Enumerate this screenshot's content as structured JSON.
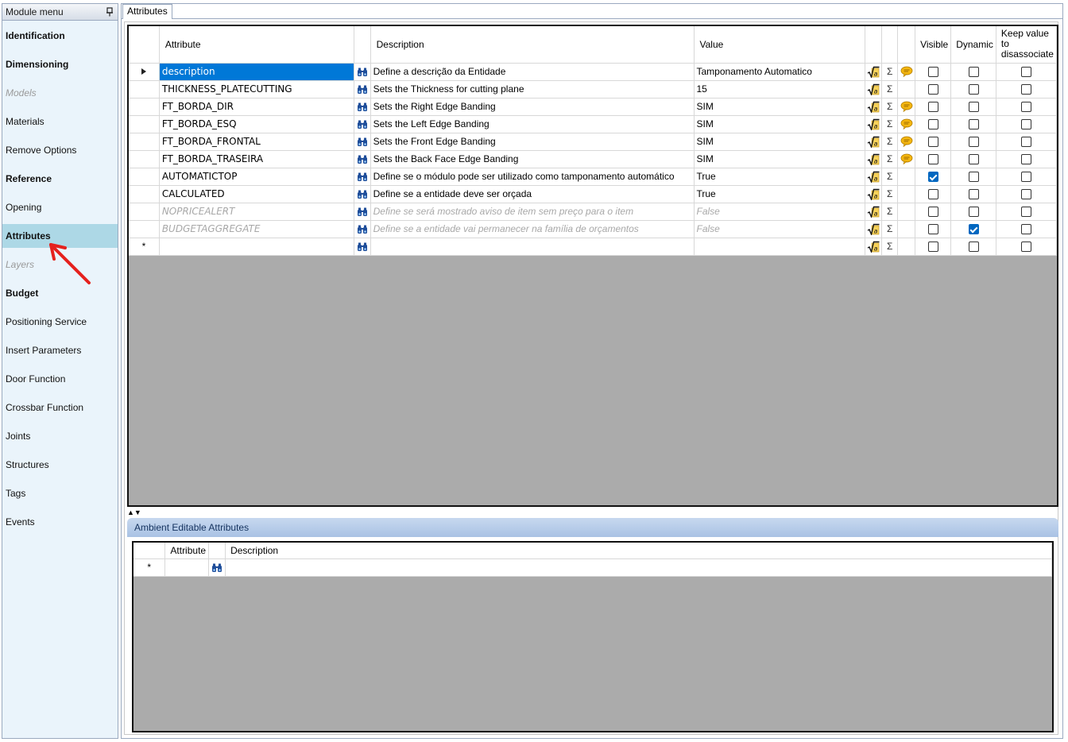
{
  "sidebar": {
    "title": "Module menu",
    "items": [
      {
        "label": "Identification",
        "style": "bold"
      },
      {
        "label": "Dimensioning",
        "style": "bold"
      },
      {
        "label": "Models",
        "style": "disabled"
      },
      {
        "label": "Materials",
        "style": "normal"
      },
      {
        "label": "Remove Options",
        "style": "normal"
      },
      {
        "label": "Reference",
        "style": "bold"
      },
      {
        "label": "Opening",
        "style": "normal"
      },
      {
        "label": "Attributes",
        "style": "active"
      },
      {
        "label": "Layers",
        "style": "disabled"
      },
      {
        "label": "Budget",
        "style": "bold"
      },
      {
        "label": "Positioning Service",
        "style": "normal"
      },
      {
        "label": "Insert Parameters",
        "style": "normal"
      },
      {
        "label": "Door Function",
        "style": "normal"
      },
      {
        "label": "Crossbar Function",
        "style": "normal"
      },
      {
        "label": "Joints",
        "style": "normal"
      },
      {
        "label": "Structures",
        "style": "normal"
      },
      {
        "label": "Tags",
        "style": "normal"
      },
      {
        "label": "Events",
        "style": "normal"
      }
    ]
  },
  "tab": {
    "label": "Attributes"
  },
  "grid": {
    "columns": {
      "attribute": "Attribute",
      "description": "Description",
      "value": "Value",
      "visible": "Visible",
      "dynamic": "Dynamic",
      "keep_value_l1": "Keep value",
      "keep_value_l2": "to",
      "keep_value_l3": "disassociate"
    },
    "rows": [
      {
        "attribute": "description",
        "description": "Define a descrição da Entidade",
        "value": "Tamponamento Automatico",
        "comment_icon": true,
        "visible": false,
        "dynamic": false,
        "keep": false,
        "state": "selected"
      },
      {
        "attribute": "THICKNESS_PLATECUTTING",
        "description": "Sets the Thickness for cutting plane",
        "value": "15",
        "comment_icon": false,
        "visible": false,
        "dynamic": false,
        "keep": false,
        "state": "normal"
      },
      {
        "attribute": "FT_BORDA_DIR",
        "description": "Sets the Right Edge Banding",
        "value": "SIM",
        "comment_icon": true,
        "visible": false,
        "dynamic": false,
        "keep": false,
        "state": "normal"
      },
      {
        "attribute": "FT_BORDA_ESQ",
        "description": "Sets the Left Edge Banding",
        "value": "SIM",
        "comment_icon": true,
        "visible": false,
        "dynamic": false,
        "keep": false,
        "state": "normal"
      },
      {
        "attribute": "FT_BORDA_FRONTAL",
        "description": "Sets the Front Edge Banding",
        "value": "SIM",
        "comment_icon": true,
        "visible": false,
        "dynamic": false,
        "keep": false,
        "state": "normal"
      },
      {
        "attribute": "FT_BORDA_TRASEIRA",
        "description": "Sets the Back Face Edge Banding",
        "value": "SIM",
        "comment_icon": true,
        "visible": false,
        "dynamic": false,
        "keep": false,
        "state": "normal"
      },
      {
        "attribute": "AUTOMATICTOP",
        "description": "Define se o módulo pode ser utilizado como tamponamento automático",
        "value": "True",
        "comment_icon": false,
        "visible": true,
        "dynamic": false,
        "keep": false,
        "state": "normal"
      },
      {
        "attribute": "CALCULATED",
        "description": "Define se a entidade deve ser orçada",
        "value": "True",
        "comment_icon": false,
        "visible": false,
        "dynamic": false,
        "keep": false,
        "state": "normal"
      },
      {
        "attribute": "NOPRICEALERT",
        "description": "Define se será mostrado aviso de item sem preço para o item",
        "value": "False",
        "comment_icon": false,
        "visible": false,
        "dynamic": false,
        "keep": false,
        "state": "dim"
      },
      {
        "attribute": "BUDGETAGGREGATE",
        "description": "Define se a entidade vai permanecer na família de orçamentos",
        "value": "False",
        "comment_icon": false,
        "visible": false,
        "dynamic": true,
        "keep": false,
        "state": "dim"
      }
    ],
    "new_row_marker": "*",
    "sigma": "Σ"
  },
  "splitter": {
    "glyph": "▲▼"
  },
  "ambient": {
    "title": "Ambient Editable Attributes",
    "columns": {
      "attribute": "Attribute",
      "description": "Description"
    },
    "new_row_marker": "*"
  },
  "colors": {
    "selection": "#0078d7",
    "active_menu": "#add8e6",
    "annotation_arrow": "#e5211d"
  }
}
